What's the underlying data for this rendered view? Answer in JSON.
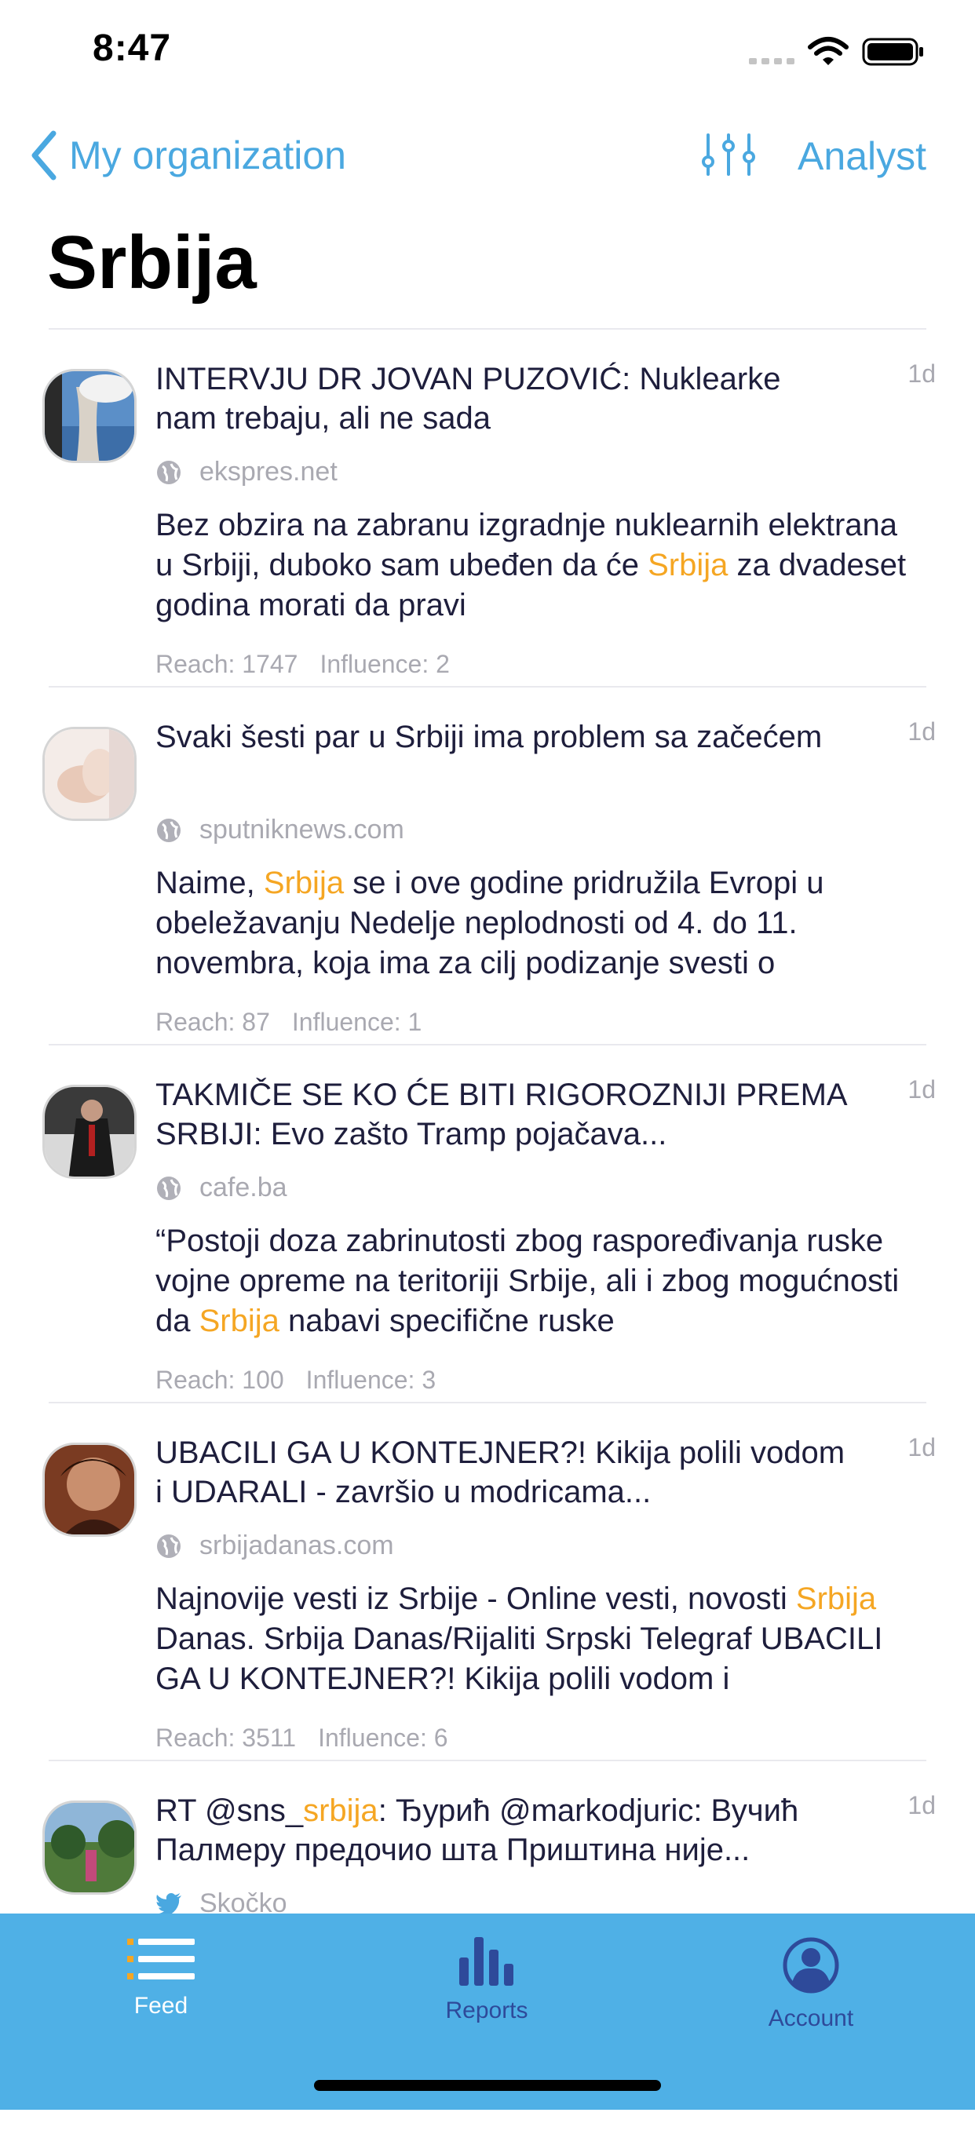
{
  "status_bar": {
    "time": "8:47"
  },
  "nav": {
    "back_label": "My organization",
    "right_label": "Analyst"
  },
  "page_title": "Srbija",
  "feed": [
    {
      "title": "INTERVJU DR JOVAN PUZOVIĆ: Nuklearke nam trebaju, ali ne sada",
      "age": "1d",
      "source_icon": "globe-icon",
      "source": "ekspres.net",
      "snippet_before": "Bez obzira na zabranu izgradnje nuklearnih elektrana u Srbiji, duboko sam ubeđen da će ",
      "snippet_highlight": "Srbija",
      "snippet_after": " za dvadeset godina morati da pravi",
      "reach": "Reach: 1747",
      "influence": "Influence: 2"
    },
    {
      "title": "Svaki šesti par u Srbiji ima problem sa začećem",
      "age": "1d",
      "source_icon": "globe-icon",
      "source": "sputniknews.com",
      "snippet_before": "Naime, ",
      "snippet_highlight": "Srbija",
      "snippet_after": " se i ove godine pridružila Evropi u obeležavanju Nedelje neplodnosti od 4. do 11. novembra, koja ima za cilj podizanje svesti o",
      "reach": "Reach: 87",
      "influence": "Influence: 1"
    },
    {
      "title": "TAKMIČE SE KO ĆE BITI RIGOROZNIJI PREMA SRBIJI: Evo zašto Tramp pojačava...",
      "age": "1d",
      "source_icon": "globe-icon",
      "source": "cafe.ba",
      "snippet_before": "“Postoji doza zabrinutosti zbog raspoređivanja ruske vojne opreme na teritoriji Srbije, ali i zbog mogućnosti da ",
      "snippet_highlight": "Srbija",
      "snippet_after": " nabavi specifične ruske",
      "reach": "Reach: 100",
      "influence": "Influence: 3"
    },
    {
      "title": "UBACILI GA U KONTEJNER?! Kikija polili vodom i UDARALI - završio u modricama...",
      "age": "1d",
      "source_icon": "globe-icon",
      "source": "srbijadanas.com",
      "snippet_before": "Najnovije vesti iz Srbije - Online vesti, novosti ",
      "snippet_highlight": "Srbija",
      "snippet_after": " Danas. Srbija Danas/Rijaliti Srpski Telegraf UBACILI GA U KONTEJNER?! Kikija polili vodom i",
      "reach": "Reach: 3511",
      "influence": "Influence: 6"
    },
    {
      "title_before": "RT @sns_",
      "title_highlight": "srbija",
      "title_after": ": Ђурић @markodjuric: Вучић Палмеру предочио шта Приштина није...",
      "age": "1d",
      "source_icon": "twitter-icon",
      "source": "Skočko"
    }
  ],
  "tabs": [
    {
      "label": "Feed",
      "icon": "list-icon",
      "active": true
    },
    {
      "label": "Reports",
      "icon": "bar-chart-icon",
      "active": false
    },
    {
      "label": "Account",
      "icon": "user-icon",
      "active": false
    }
  ],
  "colors": {
    "accent": "#4aa8e0",
    "highlight": "#f5a623",
    "tabbar": "#4fb0e6",
    "tab_inactive": "#2e4a9a"
  }
}
